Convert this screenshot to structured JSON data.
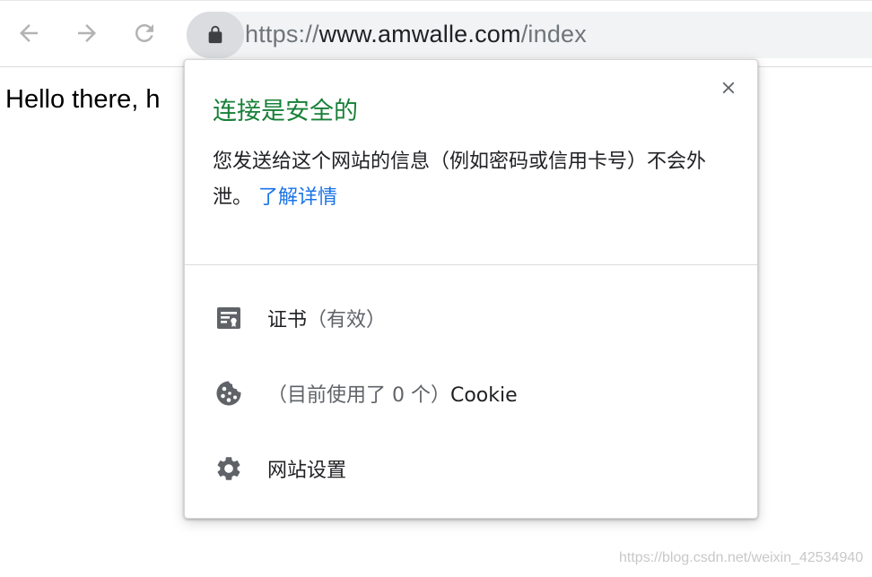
{
  "toolbar": {
    "url_scheme": "https://",
    "url_host": "www.amwalle.com",
    "url_path": "/index"
  },
  "page": {
    "text": "Hello there, h"
  },
  "popup": {
    "title": "连接是安全的",
    "description": "您发送给这个网站的信息（例如密码或信用卡号）不会外泄。",
    "learn_more": "了解详情",
    "rows": [
      {
        "label": "证书",
        "status": "（有效）",
        "icon": "certificate-icon"
      },
      {
        "label": "（目前使用了 0 个）",
        "status": "Cookie",
        "icon": "cookie-icon"
      },
      {
        "label": "网站设置",
        "icon": "gear-icon"
      }
    ]
  },
  "watermark": "https://blog.csdn.net/weixin_42534940",
  "colors": {
    "secure_green": "#188038",
    "link_blue": "#1a73e8",
    "icon_gray": "#5f6368"
  }
}
